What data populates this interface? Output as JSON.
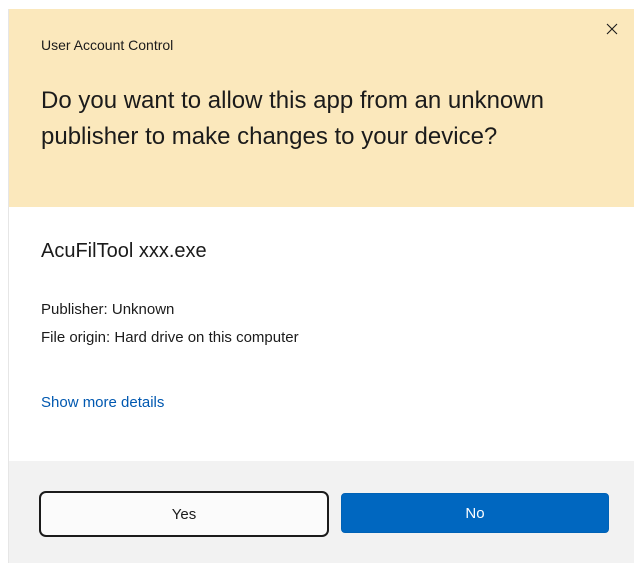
{
  "dialog": {
    "title": "User Account Control",
    "question": "Do you want to allow this app from an unknown publisher to make changes to your device?",
    "close_icon": "close-icon"
  },
  "app": {
    "name": "AcuFilTool xxx.exe",
    "publisher": "Publisher: Unknown",
    "origin": "File origin: Hard drive on this computer",
    "details_link": "Show more details"
  },
  "buttons": {
    "yes_label": "Yes",
    "no_label": "No"
  },
  "colors": {
    "header_bg": "#fbe8bc",
    "footer_bg": "#f2f2f2",
    "accent": "#0067c0",
    "link": "#0058b0"
  }
}
